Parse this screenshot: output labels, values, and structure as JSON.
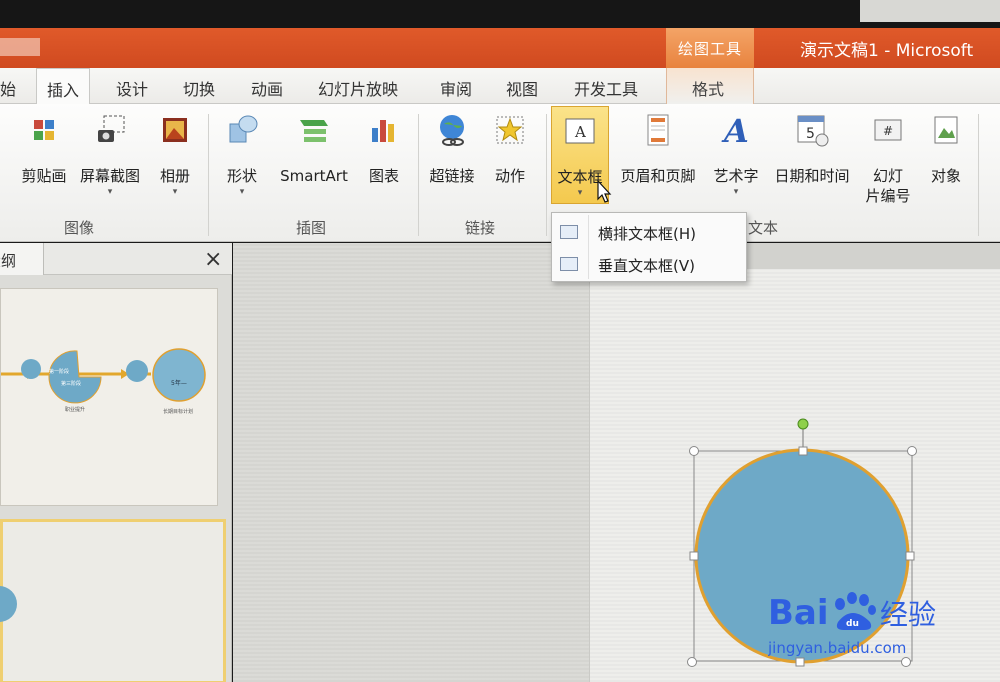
{
  "title_bar": {
    "context_tab_title": "绘图工具",
    "document_title": "演示文稿1 - Microsoft"
  },
  "tabs": [
    {
      "label": "始"
    },
    {
      "label": "插入"
    },
    {
      "label": "设计"
    },
    {
      "label": "切换"
    },
    {
      "label": "动画"
    },
    {
      "label": "幻灯片放映"
    },
    {
      "label": "审阅"
    },
    {
      "label": "视图"
    },
    {
      "label": "开发工具"
    },
    {
      "label": "格式"
    }
  ],
  "ribbon": {
    "clipart": "剪贴画",
    "screenshot": "屏幕截图",
    "album": "相册",
    "shapes": "形状",
    "smartart": "SmartArt",
    "chart": "图表",
    "hyperlink": "超链接",
    "action": "动作",
    "textbox": "文本框",
    "header_footer": "页眉和页脚",
    "wordart": "艺术字",
    "datetime": "日期和时间",
    "slide_number_1": "幻灯",
    "slide_number_2": "片编号",
    "object": "对象",
    "groups": {
      "images": "图像",
      "illustrations": "插图",
      "links": "链接",
      "text": "文本"
    }
  },
  "dropdown": {
    "horizontal": "横排文本框(H)",
    "vertical": "垂直文本框(V)"
  },
  "left_pane": {
    "tab_label": "大纲",
    "close": "×",
    "thumb_labels": [
      "第一阶段",
      "第三阶段",
      "5年—",
      "职业提升",
      "长期目标计划"
    ]
  },
  "watermark": {
    "brand": "Bai",
    "brand2": "du",
    "cn": "经验",
    "url": "jingyan.baidu.com"
  },
  "colors": {
    "title_bar": "#d04a20",
    "context_tab": "#e8833e",
    "highlight": "#f4c94e",
    "circle_fill": "#6ea9c7",
    "circle_stroke": "#e0a030",
    "watermark_blue": "#2f5fe0"
  }
}
